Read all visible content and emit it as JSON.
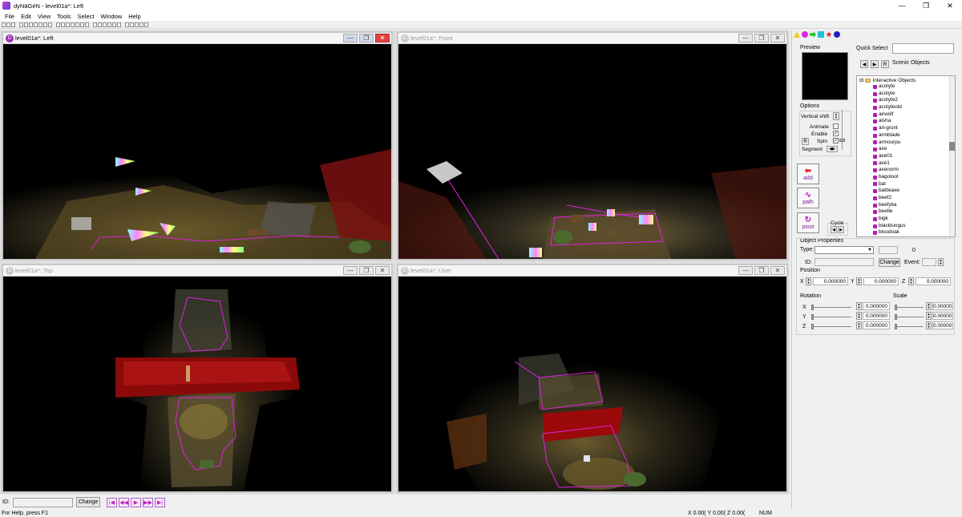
{
  "window": {
    "title": "dyNäGéN - level01a*: Left"
  },
  "menu": [
    "File",
    "Edit",
    "View",
    "Tools",
    "Select",
    "Window",
    "Help"
  ],
  "viewports": [
    {
      "title": "level01a*: Left",
      "state": "active",
      "icon": "D"
    },
    {
      "title": "level01a*: Front",
      "state": "inactive",
      "icon": "D"
    },
    {
      "title": "level01a*: Top",
      "state": "inactive",
      "icon": "D"
    },
    {
      "title": "level01a*: User",
      "state": "inactive",
      "icon": "D"
    }
  ],
  "idbar": {
    "label": "ID:",
    "change": "Change"
  },
  "statusbar": {
    "help": "For Help, press F1",
    "x": "X 0.00(",
    "y": "Y 0.00(",
    "z": "Z 0.00(",
    "num": "NUM"
  },
  "panel": {
    "preview_label": "Preview",
    "quick_select_label": "Quick Select",
    "r_label": "R",
    "scenic_objects": "Scenic Objects",
    "options_label": "Options",
    "vertical_shift": "Vertical shift",
    "animate": "Animate",
    "enable": "Enable",
    "spin": "Spin",
    "segment": "Segment",
    "opt_r": "R",
    "add": "add",
    "path": "path",
    "pivot": "pivot",
    "cycle": "Cycle",
    "tree_root": "Interactive Objects",
    "tree_items": [
      "acolyte",
      "acolyte",
      "acolyte2",
      "acolyteold",
      "airwolf",
      "aisha",
      "arl-grunt",
      "armblade",
      "armourpu",
      "axe",
      "axe01",
      "axe1",
      "axenorm",
      "bagoloot",
      "bat",
      "battleaxe",
      "beef2",
      "beefytia",
      "beetle",
      "bigk",
      "blacklungus",
      "bloodoak"
    ],
    "object_properties": "Object Properties",
    "type_label": "Type:",
    "type_value": "",
    "count_value": "0",
    "id_label": "ID:",
    "change": "Change",
    "event_label": "Event:",
    "position_label": "Position",
    "pos_x_label": "X",
    "pos_y_label": "Y",
    "pos_z_label": "Z",
    "pos_x": "0.000000",
    "pos_y": "0.000000",
    "pos_z": "0.000000",
    "rotation_label": "Rotation",
    "scale_label": "Scale",
    "rot_x_label": "X",
    "rot_y_label": "Y",
    "rot_z_label": "Z",
    "rot_x": "0.000000",
    "rot_y": "0.000000",
    "rot_z": "0.000000",
    "scale_x": "0.00000",
    "scale_y": "0.00000",
    "scale_z": "0.00000"
  },
  "colors": {
    "accent": "#9a2fb8",
    "path": "#e020e0",
    "close": "#e04343"
  }
}
